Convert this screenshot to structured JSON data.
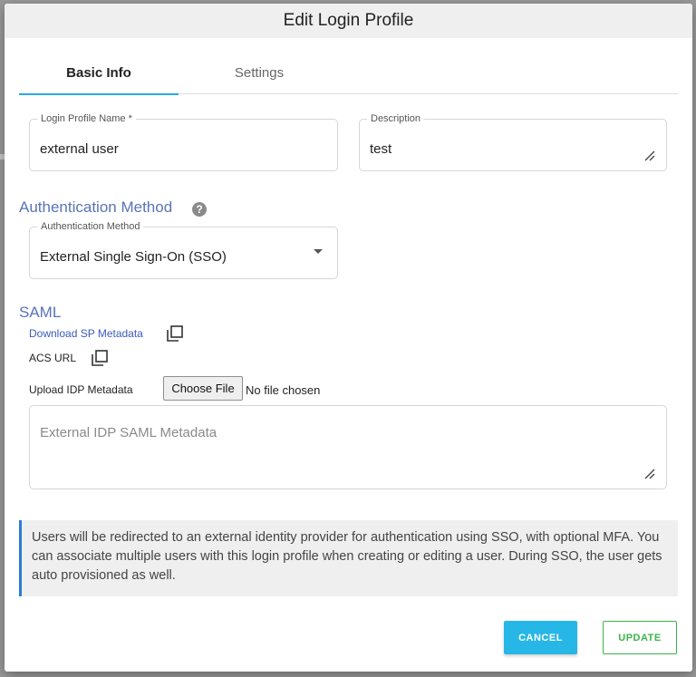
{
  "dialog": {
    "title": "Edit Login Profile"
  },
  "tabs": [
    {
      "label": "Basic Info",
      "active": true
    },
    {
      "label": "Settings",
      "active": false
    }
  ],
  "login_profile_name": {
    "label": "Login Profile Name *",
    "value": "external user"
  },
  "description": {
    "label": "Description",
    "value": "test"
  },
  "auth_method": {
    "section_title": "Authentication Method",
    "help_icon": "question-circle-icon",
    "select_label": "Authentication Method",
    "selected": "External Single Sign-On (SSO)"
  },
  "saml": {
    "section_title": "SAML",
    "download_sp_metadata": "Download SP Metadata",
    "acs_url": "ACS URL",
    "upload_label": "Upload IDP Metadata",
    "choose_file": "Choose File",
    "no_file": "No file chosen",
    "metadata_placeholder": "External IDP SAML Metadata"
  },
  "info": {
    "text": "Users will be redirected to an external identity provider for authentication using SSO, with optional MFA. You can associate multiple users with this login profile when creating or editing a user. During SSO, the user gets auto provisioned as well."
  },
  "actions": {
    "cancel": "CANCEL",
    "update": "UPDATE"
  },
  "colors": {
    "accent": "#2aa8e0",
    "section": "#5a73b8",
    "update": "#3bb34a",
    "info_border": "#2a7dd6"
  }
}
